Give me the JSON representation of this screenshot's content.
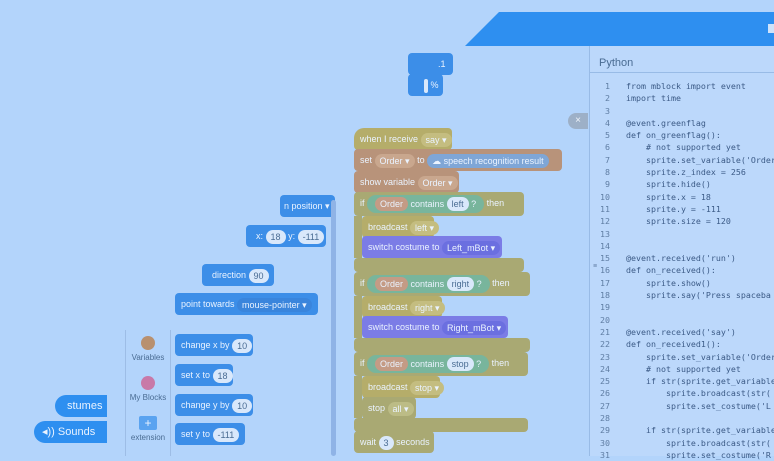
{
  "left_tabs": {
    "costumes": "stumes",
    "sounds": "Sounds",
    "sounds_icon": "speaker-icon"
  },
  "categories": [
    {
      "label": "Variables",
      "color": "#b8906f",
      "icon": "variables-icon"
    },
    {
      "label": "My Blocks",
      "color": "#c879a8",
      "icon": "my-blocks-icon"
    },
    {
      "label": "extension",
      "color": "#5aa3f0",
      "icon": "extension-icon",
      "symbol": "+"
    }
  ],
  "palette": {
    "top_partial_1": ".1",
    "top_partial_2": "%",
    "glide_label": "n position ▾",
    "goto_x_suffix": "x:",
    "goto_x": "18",
    "goto_y_label": "y:",
    "goto_y": "-111",
    "direction_label": "direction",
    "direction_value": "90",
    "point_towards": "point towards",
    "point_target": "mouse-pointer ▾",
    "change_x": "change x by",
    "change_x_val": "10",
    "set_x": "set x to",
    "set_x_val": "18",
    "change_y": "change y by",
    "change_y_val": "10",
    "set_y": "set y to",
    "set_y_val": "-111"
  },
  "script": {
    "when_receive": "when I receive",
    "when_receive_val": "say ▾",
    "set": "set",
    "set_var": "Order ▾",
    "to": "to",
    "speech": "speech recognition result",
    "show_variable": "show variable",
    "show_var": "Order ▾",
    "if_1": "if",
    "order_1": "Order",
    "contains_1": "contains",
    "val_left": "left",
    "q_1": "?",
    "then_1": "then",
    "broadcast_1": "broadcast",
    "bc_left": "left ▾",
    "switch_1": "switch costume to",
    "costume_left": "Left_mBot ▾",
    "if_2": "if",
    "order_2": "Order",
    "contains_2": "contains",
    "val_right": "right",
    "q_2": "?",
    "then_2": "then",
    "broadcast_2": "broadcast",
    "bc_right": "right ▾",
    "switch_2": "switch costume to",
    "costume_right": "Right_mBot ▾",
    "if_3": "if",
    "order_3": "Order",
    "contains_3": "contains",
    "val_stop": "stop",
    "q_3": "?",
    "then_3": "then",
    "broadcast_3": "broadcast",
    "bc_stop": "stop ▾",
    "stop": "stop",
    "stop_all": "all ▾",
    "wait": "wait",
    "wait_val": "3",
    "seconds": "seconds"
  },
  "python": {
    "title": "Python",
    "close": "×",
    "lines": [
      {
        "n": "1",
        "t": "from mblock import event"
      },
      {
        "n": "2",
        "t": "import time"
      },
      {
        "n": "3",
        "t": ""
      },
      {
        "n": "4",
        "t": "@event.greenflag"
      },
      {
        "n": "5",
        "t": "def on_greenflag():"
      },
      {
        "n": "6",
        "t": "    # not supported yet"
      },
      {
        "n": "7",
        "t": "    sprite.set_variable('Order"
      },
      {
        "n": "8",
        "t": "    sprite.z_index = 256"
      },
      {
        "n": "9",
        "t": "    sprite.hide()"
      },
      {
        "n": "10",
        "t": "    sprite.x = 18"
      },
      {
        "n": "11",
        "t": "    sprite.y = -111"
      },
      {
        "n": "12",
        "t": "    sprite.size = 120"
      },
      {
        "n": "13",
        "t": ""
      },
      {
        "n": "14",
        "t": ""
      },
      {
        "n": "15",
        "t": "@event.received('run')"
      },
      {
        "n": "16",
        "t": "def on_received():"
      },
      {
        "n": "17",
        "t": "    sprite.show()"
      },
      {
        "n": "18",
        "t": "    sprite.say('Press spaceba"
      },
      {
        "n": "19",
        "t": ""
      },
      {
        "n": "20",
        "t": ""
      },
      {
        "n": "21",
        "t": "@event.received('say')"
      },
      {
        "n": "22",
        "t": "def on_received1():"
      },
      {
        "n": "23",
        "t": "    sprite.set_variable('Order"
      },
      {
        "n": "24",
        "t": "    # not supported yet"
      },
      {
        "n": "25",
        "t": "    if str(sprite.get_variable"
      },
      {
        "n": "26",
        "t": "        sprite.broadcast(str("
      },
      {
        "n": "27",
        "t": "        sprite.set_costume('L"
      },
      {
        "n": "28",
        "t": ""
      },
      {
        "n": "29",
        "t": "    if str(sprite.get_variable"
      },
      {
        "n": "30",
        "t": "        sprite.broadcast(str("
      },
      {
        "n": "31",
        "t": "        sprite.set_costume('R"
      }
    ]
  }
}
